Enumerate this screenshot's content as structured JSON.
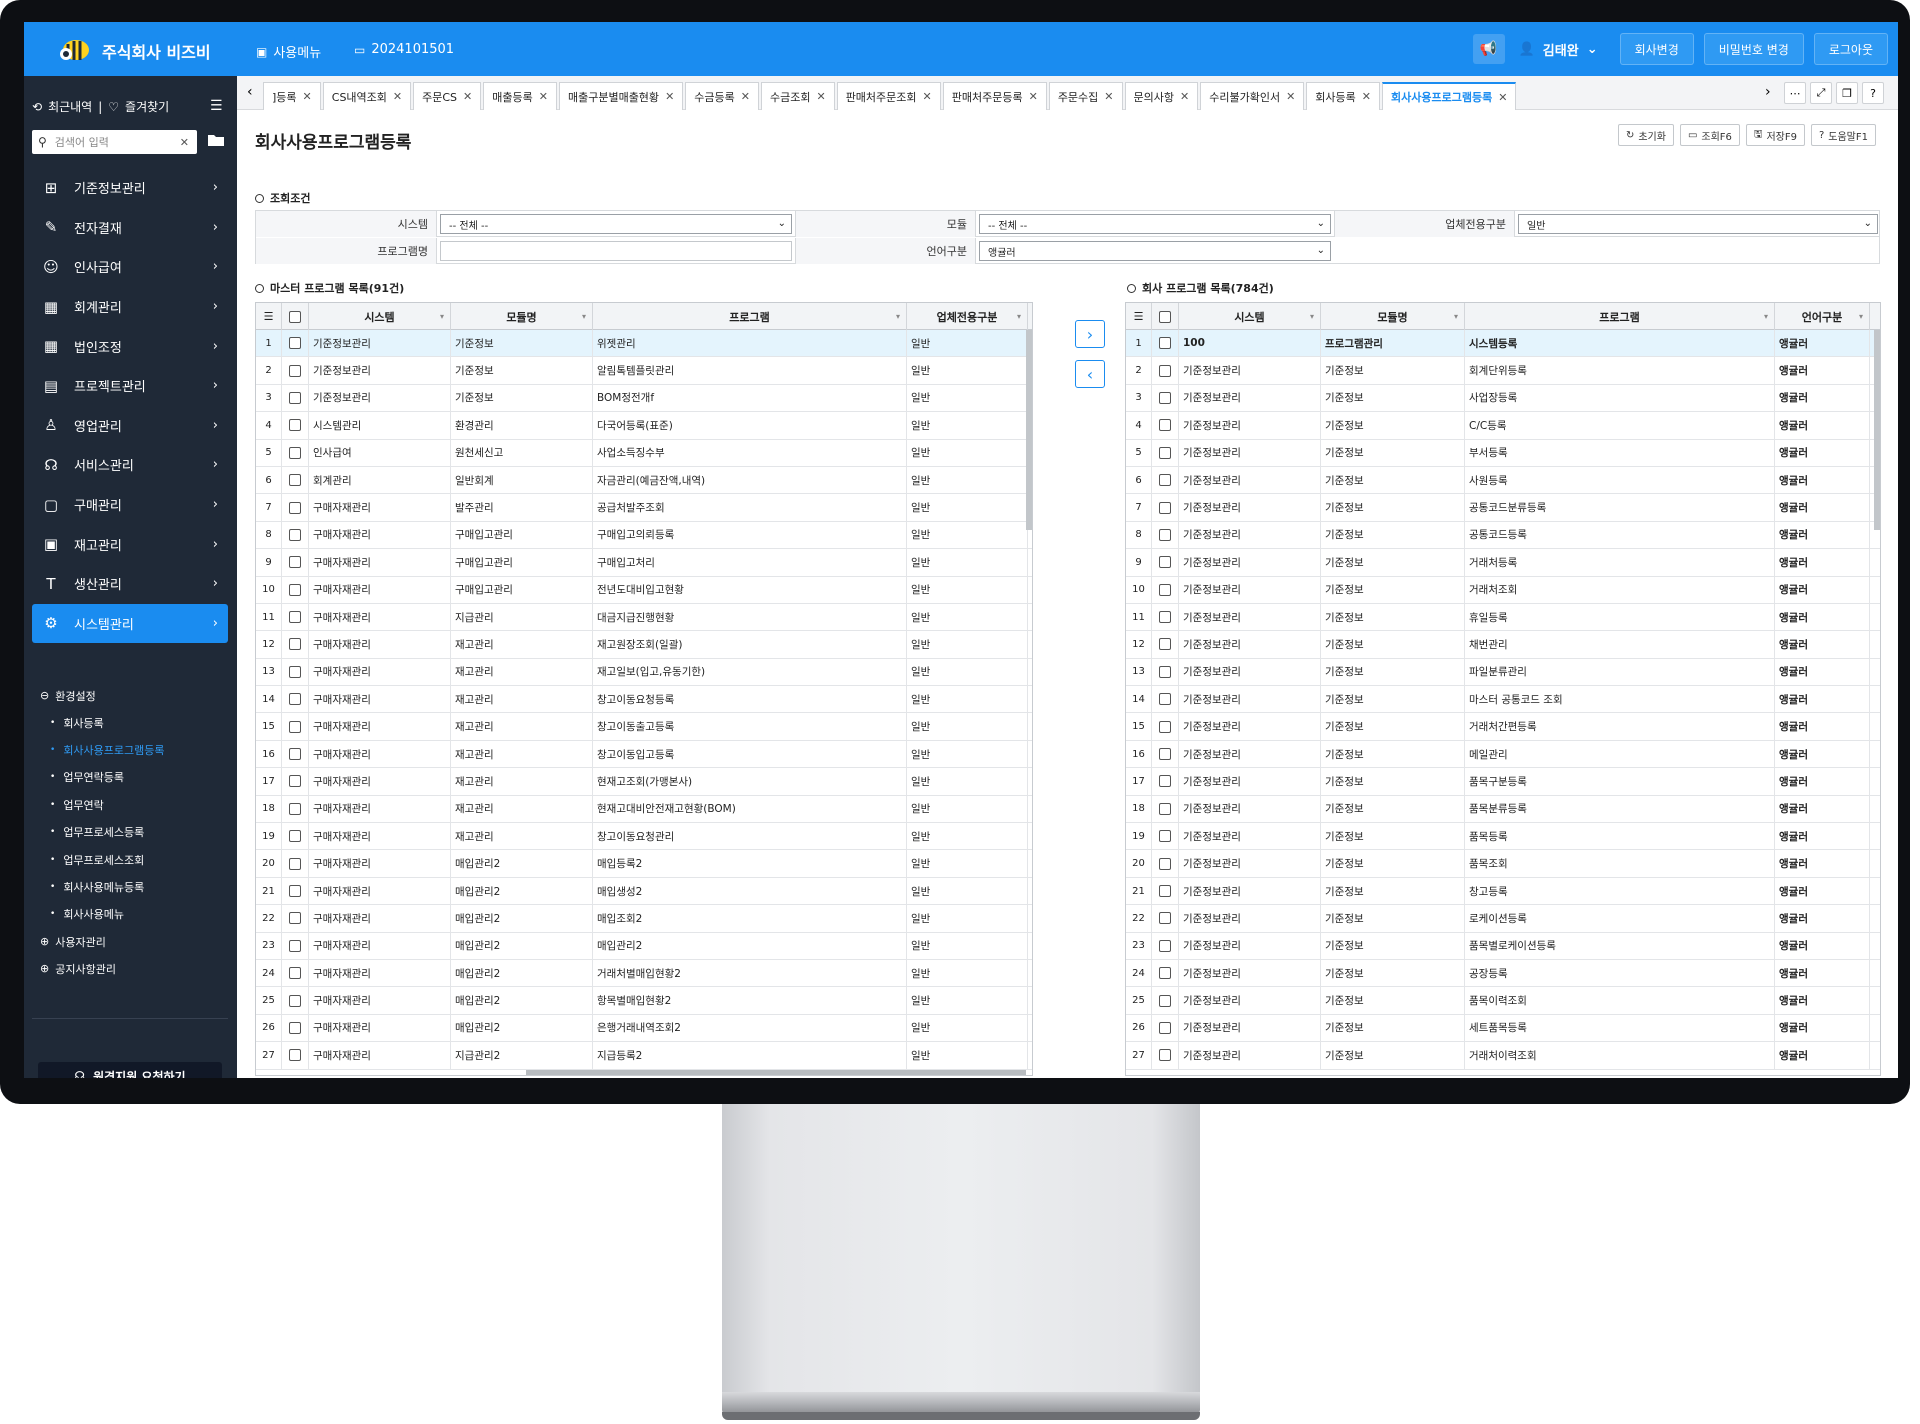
{
  "header": {
    "brand": "주식회사 비즈비",
    "nav_menu": "사용메뉴",
    "nav_code": "2024101501",
    "user_name": "김태완",
    "btn_company_change": "회사변경",
    "btn_password_change": "비밀번호 변경",
    "btn_logout": "로그아웃"
  },
  "sidebar": {
    "recent": "최근내역",
    "favorites": "즐겨찾기",
    "search_placeholder": "검색어 입력",
    "items": [
      {
        "label": "기준정보관리",
        "icon": "org-icon"
      },
      {
        "label": "전자결재",
        "icon": "edit-icon"
      },
      {
        "label": "인사급여",
        "icon": "person-card-icon"
      },
      {
        "label": "회계관리",
        "icon": "calculator-icon"
      },
      {
        "label": "법인조정",
        "icon": "calculator-icon"
      },
      {
        "label": "프로젝트관리",
        "icon": "chart-icon"
      },
      {
        "label": "영업관리",
        "icon": "user-icon"
      },
      {
        "label": "서비스관리",
        "icon": "headset-icon"
      },
      {
        "label": "구매관리",
        "icon": "cart-icon"
      },
      {
        "label": "재고관리",
        "icon": "clipboard-icon"
      },
      {
        "label": "생산관리",
        "icon": "tools-icon"
      },
      {
        "label": "시스템관리",
        "icon": "gear-icon"
      }
    ],
    "sub_group": "환경설정",
    "sub_items": [
      "회사등록",
      "회사사용프로그램등록",
      "업무연락등록",
      "업무연락",
      "업무프로세스등록",
      "업무프로세스조회",
      "회사사용메뉴등록",
      "회사사용메뉴"
    ],
    "group_user": "사용자관리",
    "group_notice": "공지사항관리",
    "remote_button": "원격지원 요청하기"
  },
  "tabs": [
    "]등록",
    "CS내역조회",
    "주문CS",
    "매출등록",
    "매출구분별매출현황",
    "수금등록",
    "수금조회",
    "판매처주문조회",
    "판매처주문등록",
    "주문수집",
    "문의사항",
    "수리불가확인서",
    "회사등록",
    "회사사용프로그램등록"
  ],
  "page": {
    "title": "회사사용프로그램등록",
    "btn_reset": "초기화",
    "btn_search": "조회F6",
    "btn_save": "저장F9",
    "btn_help": "도움말F1"
  },
  "filter": {
    "section": "조회조건",
    "system_label": "시스템",
    "system_value": "-- 전체 --",
    "module_label": "모듈",
    "module_value": "-- 전체 --",
    "biz_label": "업체전용구분",
    "biz_value": "일반",
    "program_label": "프로그램명",
    "program_value": "",
    "lang_label": "언어구분",
    "lang_value": "앵귤러"
  },
  "master": {
    "title": "마스터 프로그램 목록(91건)",
    "columns": [
      "시스템",
      "모듈명",
      "프로그램",
      "업체전용구분"
    ],
    "rows": [
      [
        "기준정보관리",
        "기준정보",
        "위젯관리",
        "일반"
      ],
      [
        "기준정보관리",
        "기준정보",
        "알림톡템플릿관리",
        "일반"
      ],
      [
        "기준정보관리",
        "기준정보",
        "BOM정전개f",
        "일반"
      ],
      [
        "시스템관리",
        "환경관리",
        "다국어등록(표준)",
        "일반"
      ],
      [
        "인사급여",
        "원천세신고",
        "사업소득징수부",
        "일반"
      ],
      [
        "회계관리",
        "일반회계",
        "자금관리(예금잔액,내역)",
        "일반"
      ],
      [
        "구매자재관리",
        "발주관리",
        "공급처발주조회",
        "일반"
      ],
      [
        "구매자재관리",
        "구매입고관리",
        "구매입고의뢰등록",
        "일반"
      ],
      [
        "구매자재관리",
        "구매입고관리",
        "구매입고처리",
        "일반"
      ],
      [
        "구매자재관리",
        "구매입고관리",
        "전년도대비입고현황",
        "일반"
      ],
      [
        "구매자재관리",
        "지급관리",
        "대금지급진행현황",
        "일반"
      ],
      [
        "구매자재관리",
        "재고관리",
        "재고원장조회(일괄)",
        "일반"
      ],
      [
        "구매자재관리",
        "재고관리",
        "재고일보(입고,유동기한)",
        "일반"
      ],
      [
        "구매자재관리",
        "재고관리",
        "창고이동요청등록",
        "일반"
      ],
      [
        "구매자재관리",
        "재고관리",
        "창고이동출고등록",
        "일반"
      ],
      [
        "구매자재관리",
        "재고관리",
        "창고이동입고등록",
        "일반"
      ],
      [
        "구매자재관리",
        "재고관리",
        "현재고조회(가맹본사)",
        "일반"
      ],
      [
        "구매자재관리",
        "재고관리",
        "현재고대비안전재고현황(BOM)",
        "일반"
      ],
      [
        "구매자재관리",
        "재고관리",
        "창고이동요청관리",
        "일반"
      ],
      [
        "구매자재관리",
        "매입관리2",
        "매입등록2",
        "일반"
      ],
      [
        "구매자재관리",
        "매입관리2",
        "매입생성2",
        "일반"
      ],
      [
        "구매자재관리",
        "매입관리2",
        "매입조회2",
        "일반"
      ],
      [
        "구매자재관리",
        "매입관리2",
        "매입관리2",
        "일반"
      ],
      [
        "구매자재관리",
        "매입관리2",
        "거래처별매입현황2",
        "일반"
      ],
      [
        "구매자재관리",
        "매입관리2",
        "항목별매입현황2",
        "일반"
      ],
      [
        "구매자재관리",
        "매입관리2",
        "은행거래내역조회2",
        "일반"
      ],
      [
        "구매자재관리",
        "지급관리2",
        "지급등록2",
        "일반"
      ]
    ]
  },
  "company": {
    "title": "회사 프로그램 목록(784건)",
    "columns": [
      "시스템",
      "모듈명",
      "프로그램",
      "언어구분"
    ],
    "rows": [
      [
        "100",
        "프로그램관리",
        "시스템등록",
        "앵귤러"
      ],
      [
        "기준정보관리",
        "기준정보",
        "회계단위등록",
        "앵귤러"
      ],
      [
        "기준정보관리",
        "기준정보",
        "사업장등록",
        "앵귤러"
      ],
      [
        "기준정보관리",
        "기준정보",
        "C/C등록",
        "앵귤러"
      ],
      [
        "기준정보관리",
        "기준정보",
        "부서등록",
        "앵귤러"
      ],
      [
        "기준정보관리",
        "기준정보",
        "사원등록",
        "앵귤러"
      ],
      [
        "기준정보관리",
        "기준정보",
        "공통코드분류등록",
        "앵귤러"
      ],
      [
        "기준정보관리",
        "기준정보",
        "공통코드등록",
        "앵귤러"
      ],
      [
        "기준정보관리",
        "기준정보",
        "거래처등록",
        "앵귤러"
      ],
      [
        "기준정보관리",
        "기준정보",
        "거래처조회",
        "앵귤러"
      ],
      [
        "기준정보관리",
        "기준정보",
        "휴일등록",
        "앵귤러"
      ],
      [
        "기준정보관리",
        "기준정보",
        "채번관리",
        "앵귤러"
      ],
      [
        "기준정보관리",
        "기준정보",
        "파일분류관리",
        "앵귤러"
      ],
      [
        "기준정보관리",
        "기준정보",
        "마스터 공통코드 조회",
        "앵귤러"
      ],
      [
        "기준정보관리",
        "기준정보",
        "거래처간편등록",
        "앵귤러"
      ],
      [
        "기준정보관리",
        "기준정보",
        "메일관리",
        "앵귤러"
      ],
      [
        "기준정보관리",
        "기준정보",
        "품목구분등록",
        "앵귤러"
      ],
      [
        "기준정보관리",
        "기준정보",
        "품목분류등록",
        "앵귤러"
      ],
      [
        "기준정보관리",
        "기준정보",
        "품목등록",
        "앵귤러"
      ],
      [
        "기준정보관리",
        "기준정보",
        "품목조회",
        "앵귤러"
      ],
      [
        "기준정보관리",
        "기준정보",
        "창고등록",
        "앵귤러"
      ],
      [
        "기준정보관리",
        "기준정보",
        "로케이션등록",
        "앵귤러"
      ],
      [
        "기준정보관리",
        "기준정보",
        "품목별로케이션등록",
        "앵귤러"
      ],
      [
        "기준정보관리",
        "기준정보",
        "공장등록",
        "앵귤러"
      ],
      [
        "기준정보관리",
        "기준정보",
        "품목이력조회",
        "앵귤러"
      ],
      [
        "기준정보관리",
        "기준정보",
        "세트품목등록",
        "앵귤러"
      ],
      [
        "기준정보관리",
        "기준정보",
        "거래처이력조회",
        "앵귤러"
      ]
    ]
  },
  "colors": {
    "brand_blue": "#1a8cf0",
    "sidebar_bg": "#1f2937",
    "selected_row": "#e4f4fd"
  }
}
